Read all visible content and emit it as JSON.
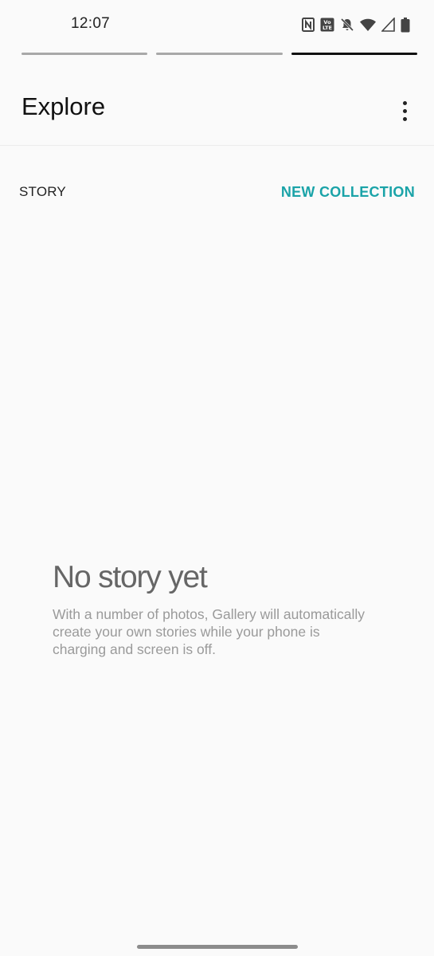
{
  "status_bar": {
    "time": "12:07",
    "icons": [
      "nfc-icon",
      "volte-icon",
      "notifications-off-icon",
      "wifi-icon",
      "cellular-signal-icon",
      "battery-icon"
    ]
  },
  "page_indicator": {
    "segments": 3,
    "active_index": 2
  },
  "app_bar": {
    "title": "Explore",
    "menu_icon": "more-vert-icon"
  },
  "section": {
    "label": "STORY",
    "action_label": "NEW COLLECTION"
  },
  "empty_state": {
    "title": "No story yet",
    "description": "With a number of photos, Gallery will automatically create your own stories while your phone is charging and screen is off."
  },
  "colors": {
    "accent": "#1aa3a8",
    "background": "#fafafa",
    "title_text": "#111111",
    "muted_text": "#9a9a9a"
  }
}
